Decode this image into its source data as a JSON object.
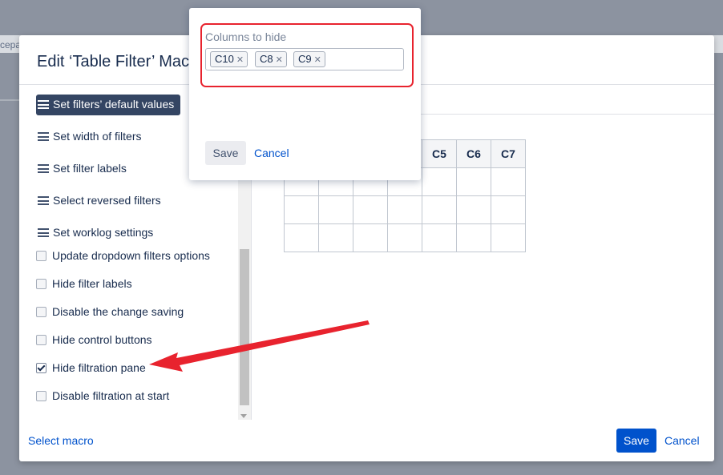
{
  "background": {
    "breadcrumb_fragment": "cepa"
  },
  "dialog": {
    "title": "Edit ‘Table Filter’ Mac",
    "menu_items": [
      {
        "label": "Set filters’ default values",
        "active": true
      },
      {
        "label": "Set width of filters",
        "active": false
      },
      {
        "label": "Set filter labels",
        "active": false
      },
      {
        "label": "Select reversed filters",
        "active": false
      },
      {
        "label": "Set worklog settings",
        "active": false
      }
    ],
    "options": [
      {
        "label": "Update dropdown filters options",
        "checked": false
      },
      {
        "label": "Hide filter labels",
        "checked": false
      },
      {
        "label": "Disable the change saving",
        "checked": false
      },
      {
        "label": "Hide control buttons",
        "checked": false
      },
      {
        "label": "Hide filtration pane",
        "checked": true
      },
      {
        "label": "Disable filtration at start",
        "checked": false
      }
    ],
    "preview_table": {
      "headers": [
        "C5",
        "C6",
        "C7"
      ]
    },
    "footer": {
      "select_macro": "Select macro",
      "save": "Save",
      "cancel": "Cancel"
    }
  },
  "popup": {
    "label": "Columns to hide",
    "tags": [
      "C10",
      "C8",
      "C9"
    ],
    "save": "Save",
    "cancel": "Cancel"
  },
  "colors": {
    "primary": "#0052cc",
    "active_menu": "#344563",
    "annotation": "#e8232e",
    "overlay": "#8c93a0"
  }
}
